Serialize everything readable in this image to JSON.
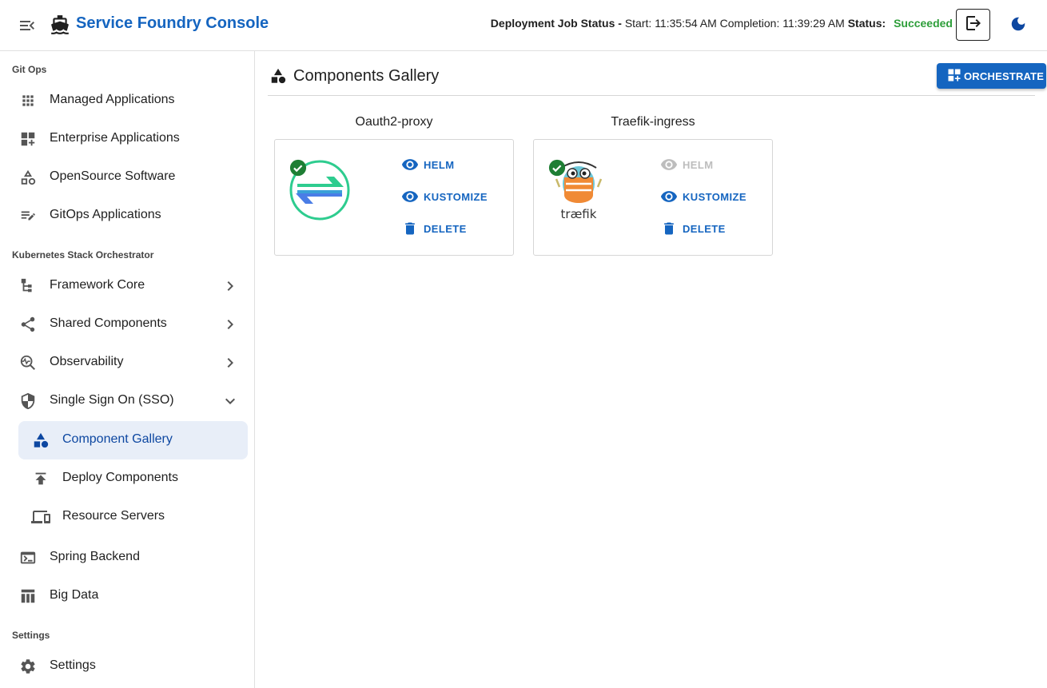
{
  "header": {
    "title": "Service Foundry Console",
    "job_status_label": "Deployment Job Status -",
    "start_label": "Start:",
    "start_time": "11:35:54 AM",
    "completion_label": "Completion:",
    "completion_time": "11:39:29 AM",
    "status_label": "Status:",
    "status_value": "Succeeded",
    "status_color": "#2e9e3a"
  },
  "sidebar": {
    "sections": [
      {
        "label": "Git Ops",
        "items": [
          {
            "label": "Managed Applications",
            "icon": "apps-grid-icon"
          },
          {
            "label": "Enterprise Applications",
            "icon": "dashboard-add-icon"
          },
          {
            "label": "OpenSource Software",
            "icon": "shapes-icon"
          },
          {
            "label": "GitOps Applications",
            "icon": "playlist-edit-icon"
          }
        ]
      },
      {
        "label": "Kubernetes Stack Orchestrator",
        "items": [
          {
            "label": "Framework Core",
            "icon": "account-tree-icon",
            "expand": "collapsed"
          },
          {
            "label": "Shared Components",
            "icon": "share-icon",
            "expand": "collapsed"
          },
          {
            "label": "Observability",
            "icon": "monitoring-search-icon",
            "expand": "collapsed"
          },
          {
            "label": "Single Sign On (SSO)",
            "icon": "shield-icon",
            "expand": "expanded",
            "children": [
              {
                "label": "Component Gallery",
                "icon": "category-icon",
                "active": true
              },
              {
                "label": "Deploy Components",
                "icon": "publish-icon"
              },
              {
                "label": "Resource Servers",
                "icon": "devices-icon"
              }
            ]
          },
          {
            "label": "Spring Backend",
            "icon": "terminal-icon"
          },
          {
            "label": "Big Data",
            "icon": "table-icon"
          }
        ]
      },
      {
        "label": "Settings",
        "items": [
          {
            "label": "Settings",
            "icon": "gear-icon"
          }
        ]
      }
    ]
  },
  "main": {
    "title": "Components Gallery",
    "orchestrate_label": "ORCHESTRATE",
    "cards": [
      {
        "name": "Oauth2-proxy",
        "logo": "oauth2-proxy-logo",
        "deployed": true,
        "actions": [
          {
            "label": "HELM",
            "icon": "eye-icon",
            "enabled": true
          },
          {
            "label": "KUSTOMIZE",
            "icon": "eye-icon",
            "enabled": true
          },
          {
            "label": "DELETE",
            "icon": "trash-icon",
            "enabled": true
          }
        ]
      },
      {
        "name": "Traefik-ingress",
        "logo": "traefik-logo",
        "logo_text": "træfik",
        "deployed": true,
        "actions": [
          {
            "label": "HELM",
            "icon": "eye-icon",
            "enabled": false
          },
          {
            "label": "KUSTOMIZE",
            "icon": "eye-icon",
            "enabled": true
          },
          {
            "label": "DELETE",
            "icon": "trash-icon",
            "enabled": true
          }
        ]
      }
    ]
  },
  "colors": {
    "brand": "#1565c0",
    "active_bg": "#e8eef8",
    "success": "#1e7e34",
    "disabled": "#bdbdbd"
  }
}
